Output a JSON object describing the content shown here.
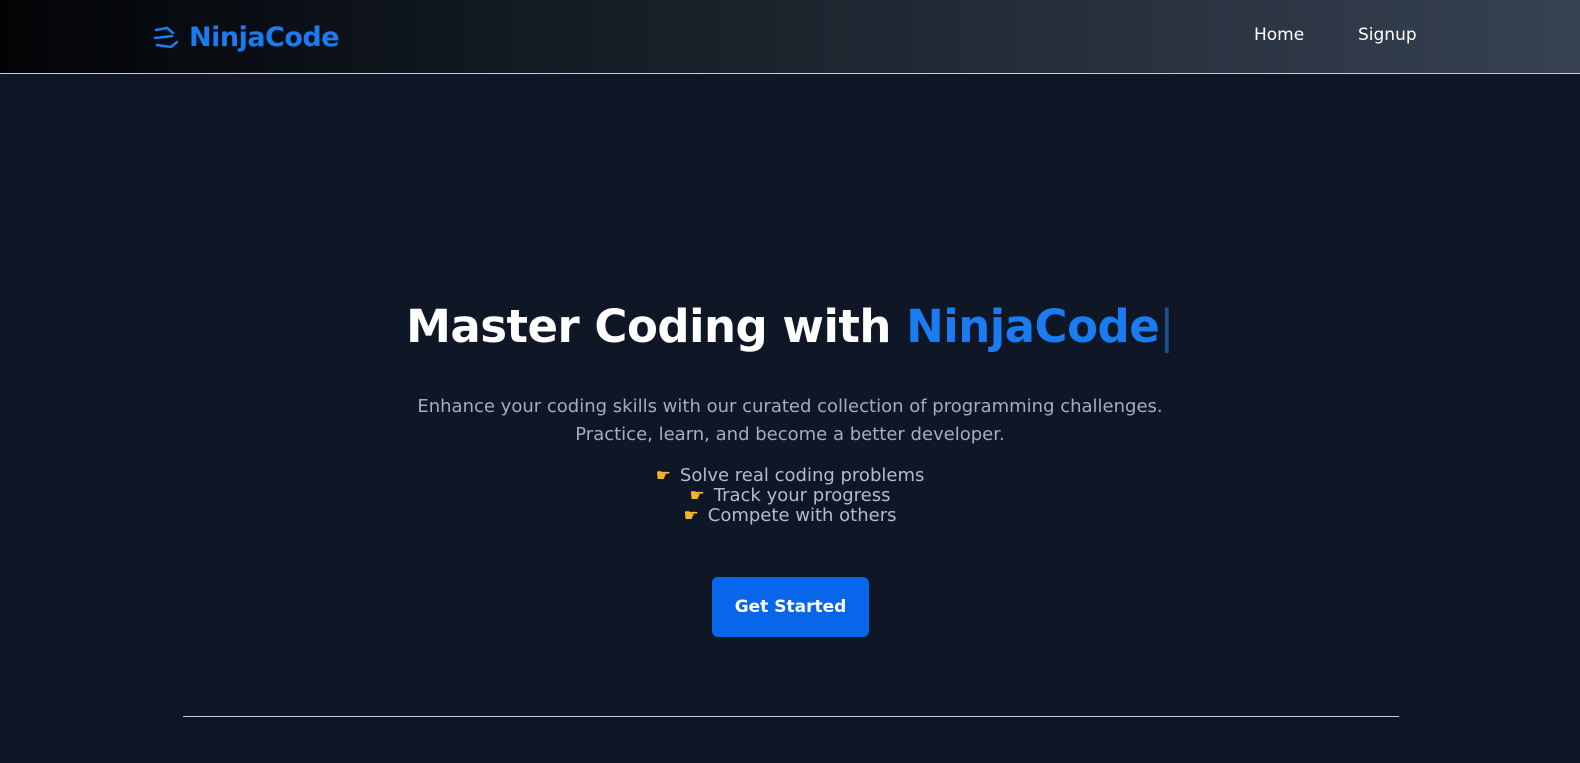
{
  "navbar": {
    "brand": "NinjaCode",
    "brand_icon": "code-logo-icon",
    "links": [
      "Home",
      "Signup"
    ]
  },
  "hero": {
    "title_prefix": "Master Coding with ",
    "title_accent": "NinjaCode",
    "cursor": "|",
    "description_line1": "Enhance your coding skills with our curated collection of programming challenges.",
    "description_line2": "Practice, learn, and become a better developer.",
    "features": [
      "Solve real coding problems",
      "Track your progress",
      "Compete with others"
    ],
    "feature_icon": "pointing-hand-icon",
    "cta_label": "Get Started"
  },
  "colors": {
    "background": "#0f1727",
    "accent": "#1a7cf0",
    "button": "#0866eb",
    "muted_text": "#a3adbb",
    "icon": "#f4b528"
  }
}
